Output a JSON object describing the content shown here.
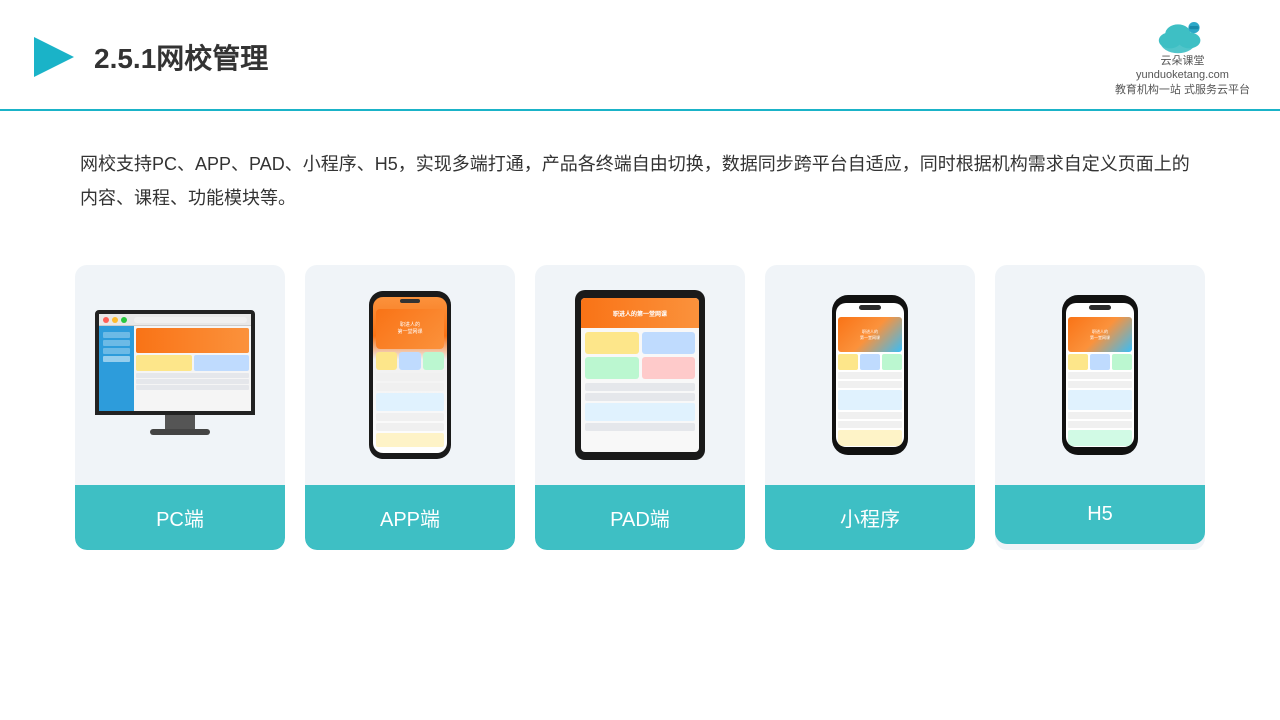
{
  "header": {
    "title": "2.5.1网校管理",
    "logo_line1": "云朵课堂",
    "logo_sub": "yunduoketang.com",
    "logo_tagline": "教育机构一站\n式服务云平台"
  },
  "description": {
    "text": "网校支持PC、APP、PAD、小程序、H5，实现多端打通，产品各终端自由切换，数据同步跨平台自适应，同时根据机构需求自定义页面上的内容、课程、功能模块等。"
  },
  "cards": [
    {
      "id": "pc",
      "label": "PC端"
    },
    {
      "id": "app",
      "label": "APP端"
    },
    {
      "id": "pad",
      "label": "PAD端"
    },
    {
      "id": "miniprogram",
      "label": "小程序"
    },
    {
      "id": "h5",
      "label": "H5"
    }
  ],
  "brand_color": "#3ebfc4",
  "accent_color": "#1ab3c8"
}
